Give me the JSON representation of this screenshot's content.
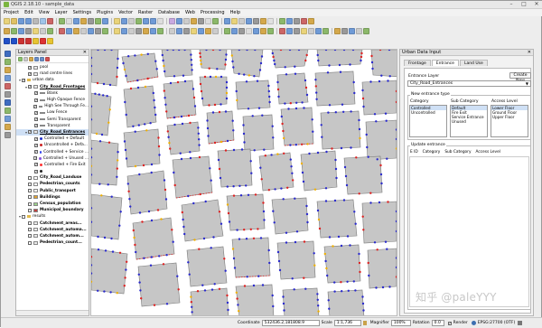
{
  "window": {
    "title": "QGIS 2.18.10 - sample_data"
  },
  "menubar": [
    "Project",
    "Edit",
    "View",
    "Layer",
    "Settings",
    "Plugins",
    "Vector",
    "Raster",
    "Database",
    "Web",
    "Processing",
    "Help"
  ],
  "layers_panel": {
    "title": "Layers Panel",
    "items": [
      {
        "label": "pool",
        "level": 1
      },
      {
        "label": "road centre lines",
        "level": 1
      },
      {
        "label": "urban data",
        "level": 0,
        "group": true
      },
      {
        "label": "City_Road_Frontages",
        "level": 1,
        "bold": true
      },
      {
        "label": "Blank",
        "level": 2
      },
      {
        "label": "High Opaque Fence",
        "level": 2
      },
      {
        "label": "High See Through Fe...",
        "level": 2
      },
      {
        "label": "Low Fence",
        "level": 2
      },
      {
        "label": "Semi Transparent",
        "level": 2
      },
      {
        "label": "Transparent",
        "level": 2
      },
      {
        "label": "City_Road_Entrances",
        "level": 1,
        "bold": true,
        "selected": true
      },
      {
        "label": "Controlled + Default",
        "level": 2
      },
      {
        "label": "Uncontrolled + Defa...",
        "level": 2
      },
      {
        "label": "Controlled + Service ...",
        "level": 2
      },
      {
        "label": "Controlled + Unused ...",
        "level": 2
      },
      {
        "label": "Controlled + Fire Exit",
        "level": 2
      },
      {
        "label": "",
        "level": 2
      },
      {
        "label": "City_Road_Landuse",
        "level": 1,
        "bold": true
      },
      {
        "label": "Pedestrian_counts",
        "level": 1,
        "bold": true
      },
      {
        "label": "Public_transport",
        "level": 1,
        "bold": true
      },
      {
        "label": "Buildings",
        "level": 1,
        "bold": true
      },
      {
        "label": "Census_population",
        "level": 1,
        "bold": true
      },
      {
        "label": "Municipal_boundary",
        "level": 1,
        "bold": true
      },
      {
        "label": "results",
        "level": 0,
        "group": true
      },
      {
        "label": "Catchment_areas...",
        "level": 1,
        "bold": true
      },
      {
        "label": "Catchment_automa...",
        "level": 1,
        "bold": true
      },
      {
        "label": "Catchment_autom...",
        "level": 1,
        "bold": true
      },
      {
        "label": "Pedestrian_count...",
        "level": 1,
        "bold": true
      }
    ]
  },
  "right_panel": {
    "title": "Urban Data Input",
    "tabs": [
      "Frontage",
      "Entrance",
      "Land Use"
    ],
    "active_tab": "Entrance",
    "entrance_layer_label": "Entrance Layer",
    "create_new_button": "Create New",
    "entrance_layer_value": "City_Road_Entrances",
    "new_entrance_type_label": "New entrance type",
    "category_label": "Category",
    "sub_category_label": "Sub Category",
    "access_level_label": "Access Level",
    "categories": [
      "Controlled",
      "Uncontrolled"
    ],
    "sub_categories": [
      "Default",
      "Fire Exit",
      "Service Entrance",
      "Unused"
    ],
    "access_levels": [
      "Lower Floor",
      "Ground Floor",
      "Upper Floor"
    ],
    "update_entrance_label": "Update entrance",
    "table_headers": [
      "E ID",
      "Category",
      "Sub Category",
      "Access Level"
    ]
  },
  "status": {
    "coordinate_label": "Coordinate",
    "coordinate_value": "532436.2,181808.9",
    "scale_label": "Scale",
    "scale_value": "1:1,736",
    "magnifier_label": "Magnifier",
    "magnifier_value": "100%",
    "rotation_label": "Rotation",
    "rotation_value": "0.0",
    "render_label": "Render",
    "crs": "EPSG:27700 (OTF)"
  },
  "watermark": "知乎 @paleYYY"
}
